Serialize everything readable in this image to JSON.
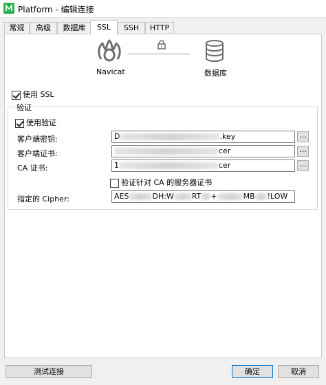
{
  "window": {
    "title": "Platform - 编辑连接"
  },
  "tabs": [
    {
      "label": "常规"
    },
    {
      "label": "高级"
    },
    {
      "label": "数据库"
    },
    {
      "label": "SSL"
    },
    {
      "label": "SSH"
    },
    {
      "label": "HTTP"
    }
  ],
  "active_tab": "SSL",
  "diagram": {
    "client_label": "Navicat",
    "server_label": "数据库"
  },
  "ssl": {
    "use_ssl_label": "使用 SSL",
    "use_ssl_checked": true,
    "auth_group_title": "验证",
    "use_auth_label": "使用验证",
    "use_auth_checked": true,
    "client_key_label": "客户端密钥:",
    "client_key_prefix": "D",
    "client_key_suffix": ".key",
    "client_cert_label": "客户端证书:",
    "client_cert_suffix": "cer",
    "ca_cert_label": "CA 证书:",
    "ca_cert_prefix": "1",
    "ca_cert_suffix": "cer",
    "verify_ca_label": "验证针对 CA 的服务器证书",
    "verify_ca_checked": false,
    "cipher_label": "指定的 Cipher:",
    "cipher_text": [
      "AES",
      "DH:W",
      "RT",
      "+",
      "MB",
      "!LOW"
    ]
  },
  "browse_label": "...",
  "footer": {
    "test_label": "测试连接",
    "ok_label": "确定",
    "cancel_label": "取消"
  }
}
